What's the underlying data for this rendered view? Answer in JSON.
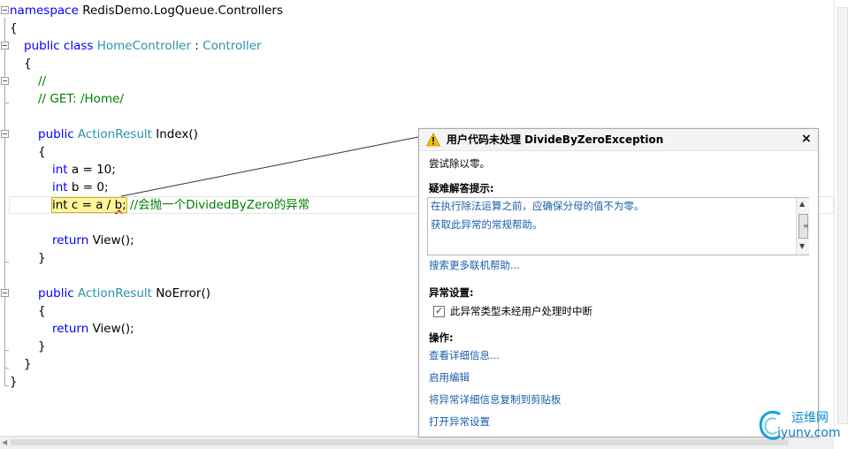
{
  "code": {
    "namespace_kw": "namespace",
    "namespace_name": "RedisDemo.LogQueue.Controllers",
    "brace_open": "{",
    "brace_close": "}",
    "public": "public",
    "class": "class",
    "class_name": "HomeController",
    "colon": " : ",
    "base_class": "Controller",
    "comment1": "//",
    "comment2": "// GET: /Home/",
    "return_type": "ActionResult",
    "index_sig": " Index()",
    "int_kw": "int",
    "decl_a": " a = 10;",
    "decl_b": " b = 0;",
    "decl_c_int": "int",
    "decl_c_rest": " c = a / ",
    "decl_c_b": "b",
    "decl_c_semi": ";",
    "decl_c_comment": " //会抛一个DividedByZero的异常",
    "return_kw": "return",
    "return_rest": " View();",
    "noerror_sig": " NoError()"
  },
  "exception_popup": {
    "title": "用户代码未处理 DivideByZeroException",
    "message": "尝试除以零。",
    "tips_header": "疑难解答提示:",
    "tips": [
      "在执行除法运算之前，应确保分母的值不为零。",
      "获取此异常的常规帮助。"
    ],
    "search_link": "搜索更多联机帮助...",
    "settings_header": "异常设置:",
    "checkbox_label": "此异常类型未经用户处理时中断",
    "checkbox_checked": true,
    "actions_header": "操作:",
    "actions": [
      "查看详细信息...",
      "启用编辑",
      "将异常详细信息复制到剪贴板",
      "打开异常设置"
    ],
    "close_glyph": "×"
  },
  "watermark": {
    "cn": "运维网",
    "en": "iyunv.com"
  },
  "colors": {
    "keyword": "#0000ff",
    "type": "#2b91af",
    "comment": "#008000",
    "highlight": "#fff59b",
    "link": "#1a5ea8",
    "warning": "#f2c200"
  },
  "icons": [
    "warning-icon",
    "close-icon",
    "checkbox-icon",
    "fold-icon",
    "watermark-logo-icon"
  ]
}
